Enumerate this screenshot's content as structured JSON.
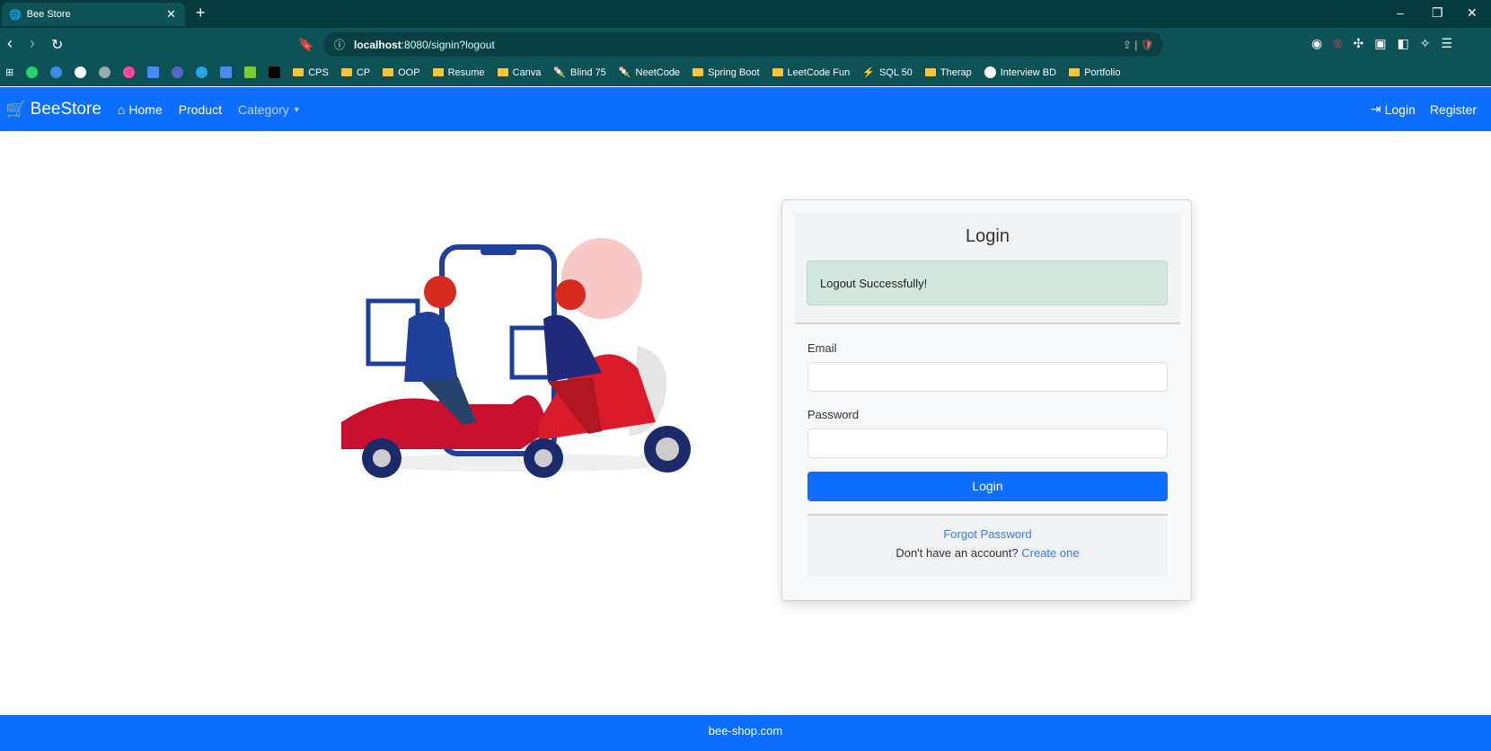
{
  "browser": {
    "tab_title": "Bee Store",
    "url_host": "localhost",
    "url_rest": ":8080/signin?logout",
    "bookmarks": [
      "CPS",
      "CP",
      "OOP",
      "Resume",
      "Canva",
      "Blind 75",
      "NeetCode",
      "Spring Boot",
      "LeetCode Fun",
      "SQL 50",
      "Therap",
      "Interview BD",
      "Portfolio"
    ]
  },
  "navbar": {
    "brand": "BeeStore",
    "home": "Home",
    "product": "Product",
    "category": "Category",
    "login": "Login",
    "register": "Register"
  },
  "login_card": {
    "title": "Login",
    "alert": "Logout Successfully!",
    "email_label": "Email",
    "email_value": "",
    "password_label": "Password",
    "password_value": "",
    "submit": "Login",
    "forgot": "Forgot Password",
    "no_account": "Don't have an account?",
    "create": "Create one"
  },
  "footer": {
    "text": "bee-shop.com"
  },
  "colors": {
    "primary": "#0d6efd",
    "alert_bg": "#d1e7dd",
    "browser_bg": "#0d5257"
  }
}
